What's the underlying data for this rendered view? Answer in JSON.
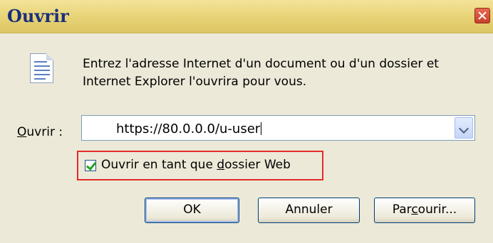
{
  "window": {
    "title": "Ouvrir"
  },
  "description": {
    "line1": "Entrez l'adresse Internet d'un document ou d'un dossier et",
    "line2": "Internet Explorer l'ouvrira pour vous."
  },
  "open_field": {
    "label_prefix": "O",
    "label_rest": "uvrir :",
    "value": "https://80.0.0.0/u-user"
  },
  "web_folder_option": {
    "checked": true,
    "label_before": "Ouvrir en tant que ",
    "label_underlined": "d",
    "label_after": "ossier Web"
  },
  "buttons": {
    "ok": "OK",
    "cancel": "Annuler",
    "browse_before": "Par",
    "browse_underlined": "c",
    "browse_after": "ourir..."
  },
  "icons": {
    "document": "document-icon",
    "close": "close-icon",
    "dropdown": "chevron-down-icon",
    "check": "checkmark-icon"
  },
  "colors": {
    "titlebar": "#e9d57a",
    "title_text": "#1a2f7a",
    "highlight_border": "#e52b2b",
    "dialog_bg": "#ece9d8"
  }
}
